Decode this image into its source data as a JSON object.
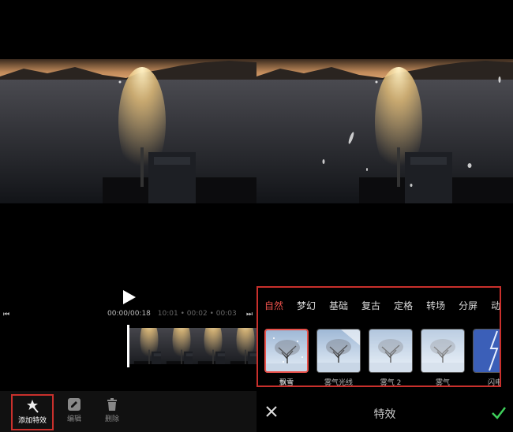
{
  "left": {
    "timecode": "00:00/00:18",
    "ticks": [
      "10:01",
      "00:02",
      "00:03"
    ],
    "toolbar": {
      "add_effect": "添加特效",
      "edit": "编辑",
      "delete": "删除"
    }
  },
  "right": {
    "tabs": [
      "自然",
      "梦幻",
      "基础",
      "复古",
      "定格",
      "转场",
      "分屏",
      "动感"
    ],
    "active_tab": "自然",
    "effects": [
      {
        "name": "飘雪",
        "icon": "tree-snow-thumb"
      },
      {
        "name": "雾气光线",
        "icon": "tree-fog-light-thumb"
      },
      {
        "name": "雾气 2",
        "icon": "tree-fog2-thumb"
      },
      {
        "name": "雾气",
        "icon": "tree-fog-thumb"
      },
      {
        "name": "闪电",
        "icon": "lightning-thumb"
      }
    ],
    "selected_effect": "飘雪",
    "title": "特效"
  },
  "colors": {
    "accent_red": "#e8504a",
    "highlight_border": "#c9302c",
    "confirm_green": "#3ecf5a"
  }
}
